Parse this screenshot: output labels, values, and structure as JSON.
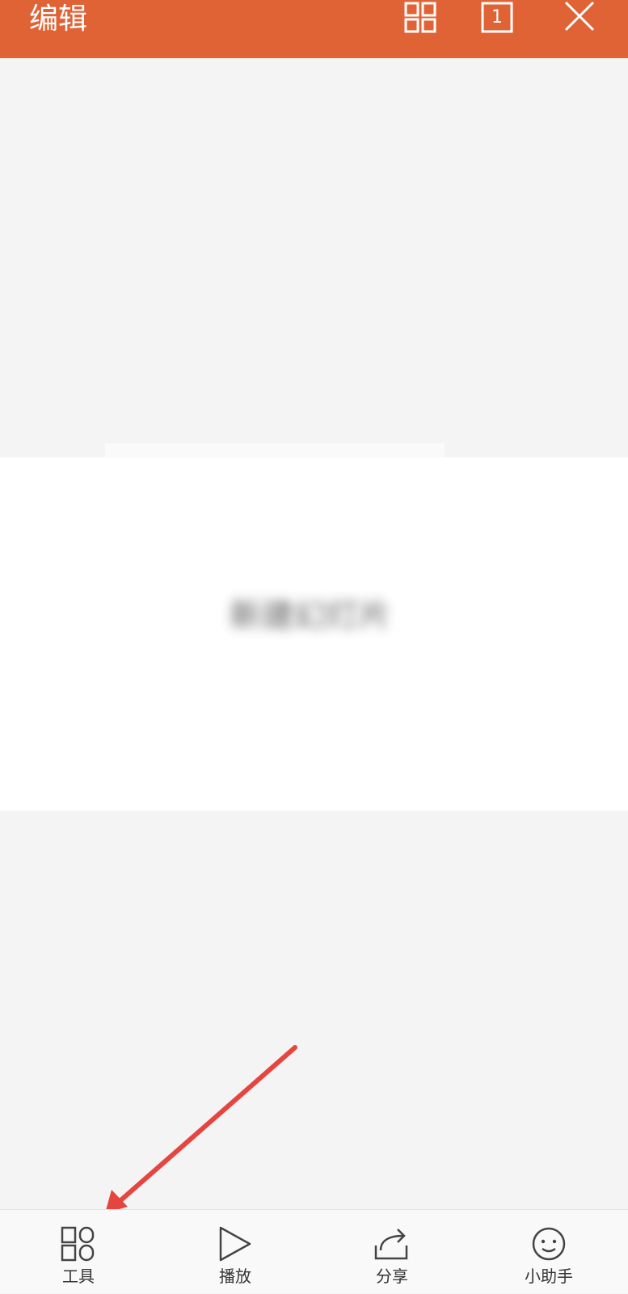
{
  "header": {
    "title": "编辑",
    "page_number": "1",
    "icons": [
      "grid-view-icon",
      "page-number-icon",
      "close-icon"
    ]
  },
  "slide": {
    "blurred_text": "新建幻灯片"
  },
  "bottom_bar": {
    "tabs": [
      {
        "label": "工具",
        "icon": "tools-icon"
      },
      {
        "label": "播放",
        "icon": "play-icon"
      },
      {
        "label": "分享",
        "icon": "share-icon"
      },
      {
        "label": "小助手",
        "icon": "assistant-icon"
      }
    ]
  },
  "colors": {
    "header_bg": "#e06336",
    "canvas_bg": "#f4f4f4",
    "slide_bg": "#ffffff",
    "annotation_arrow": "#e5453f"
  }
}
